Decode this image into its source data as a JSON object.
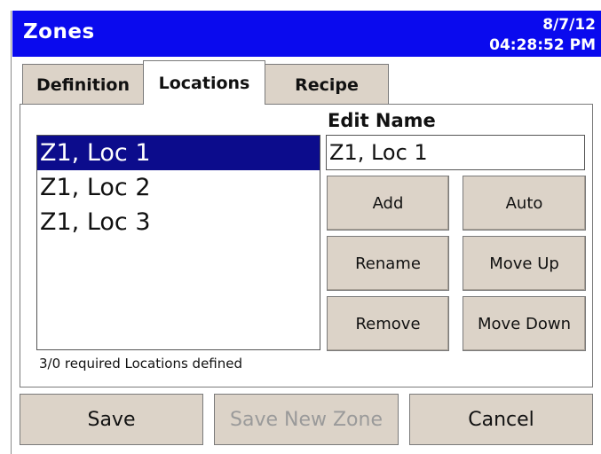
{
  "window": {
    "title": "Zones",
    "date": "8/7/12",
    "time": "04:28:52 PM"
  },
  "tabs": [
    {
      "label": "Definition",
      "active": false
    },
    {
      "label": "Locations",
      "active": true
    },
    {
      "label": "Recipe",
      "active": false
    }
  ],
  "locations": {
    "items": [
      "Z1, Loc 1",
      "Z1, Loc 2",
      "Z1, Loc 3"
    ],
    "selected_index": 0
  },
  "edit": {
    "label": "Edit Name",
    "value": "Z1, Loc 1"
  },
  "buttons": {
    "add": "Add",
    "auto": "Auto",
    "rename": "Rename",
    "move_up": "Move Up",
    "remove": "Remove",
    "move_down": "Move Down"
  },
  "status_text": "3/0 required Locations defined",
  "footer": {
    "save": "Save",
    "save_new_zone": "Save New Zone",
    "cancel": "Cancel"
  },
  "colors": {
    "titlebar": "#0a0aee",
    "selection": "#0c0c8c",
    "button_face": "#dcd3c8"
  }
}
